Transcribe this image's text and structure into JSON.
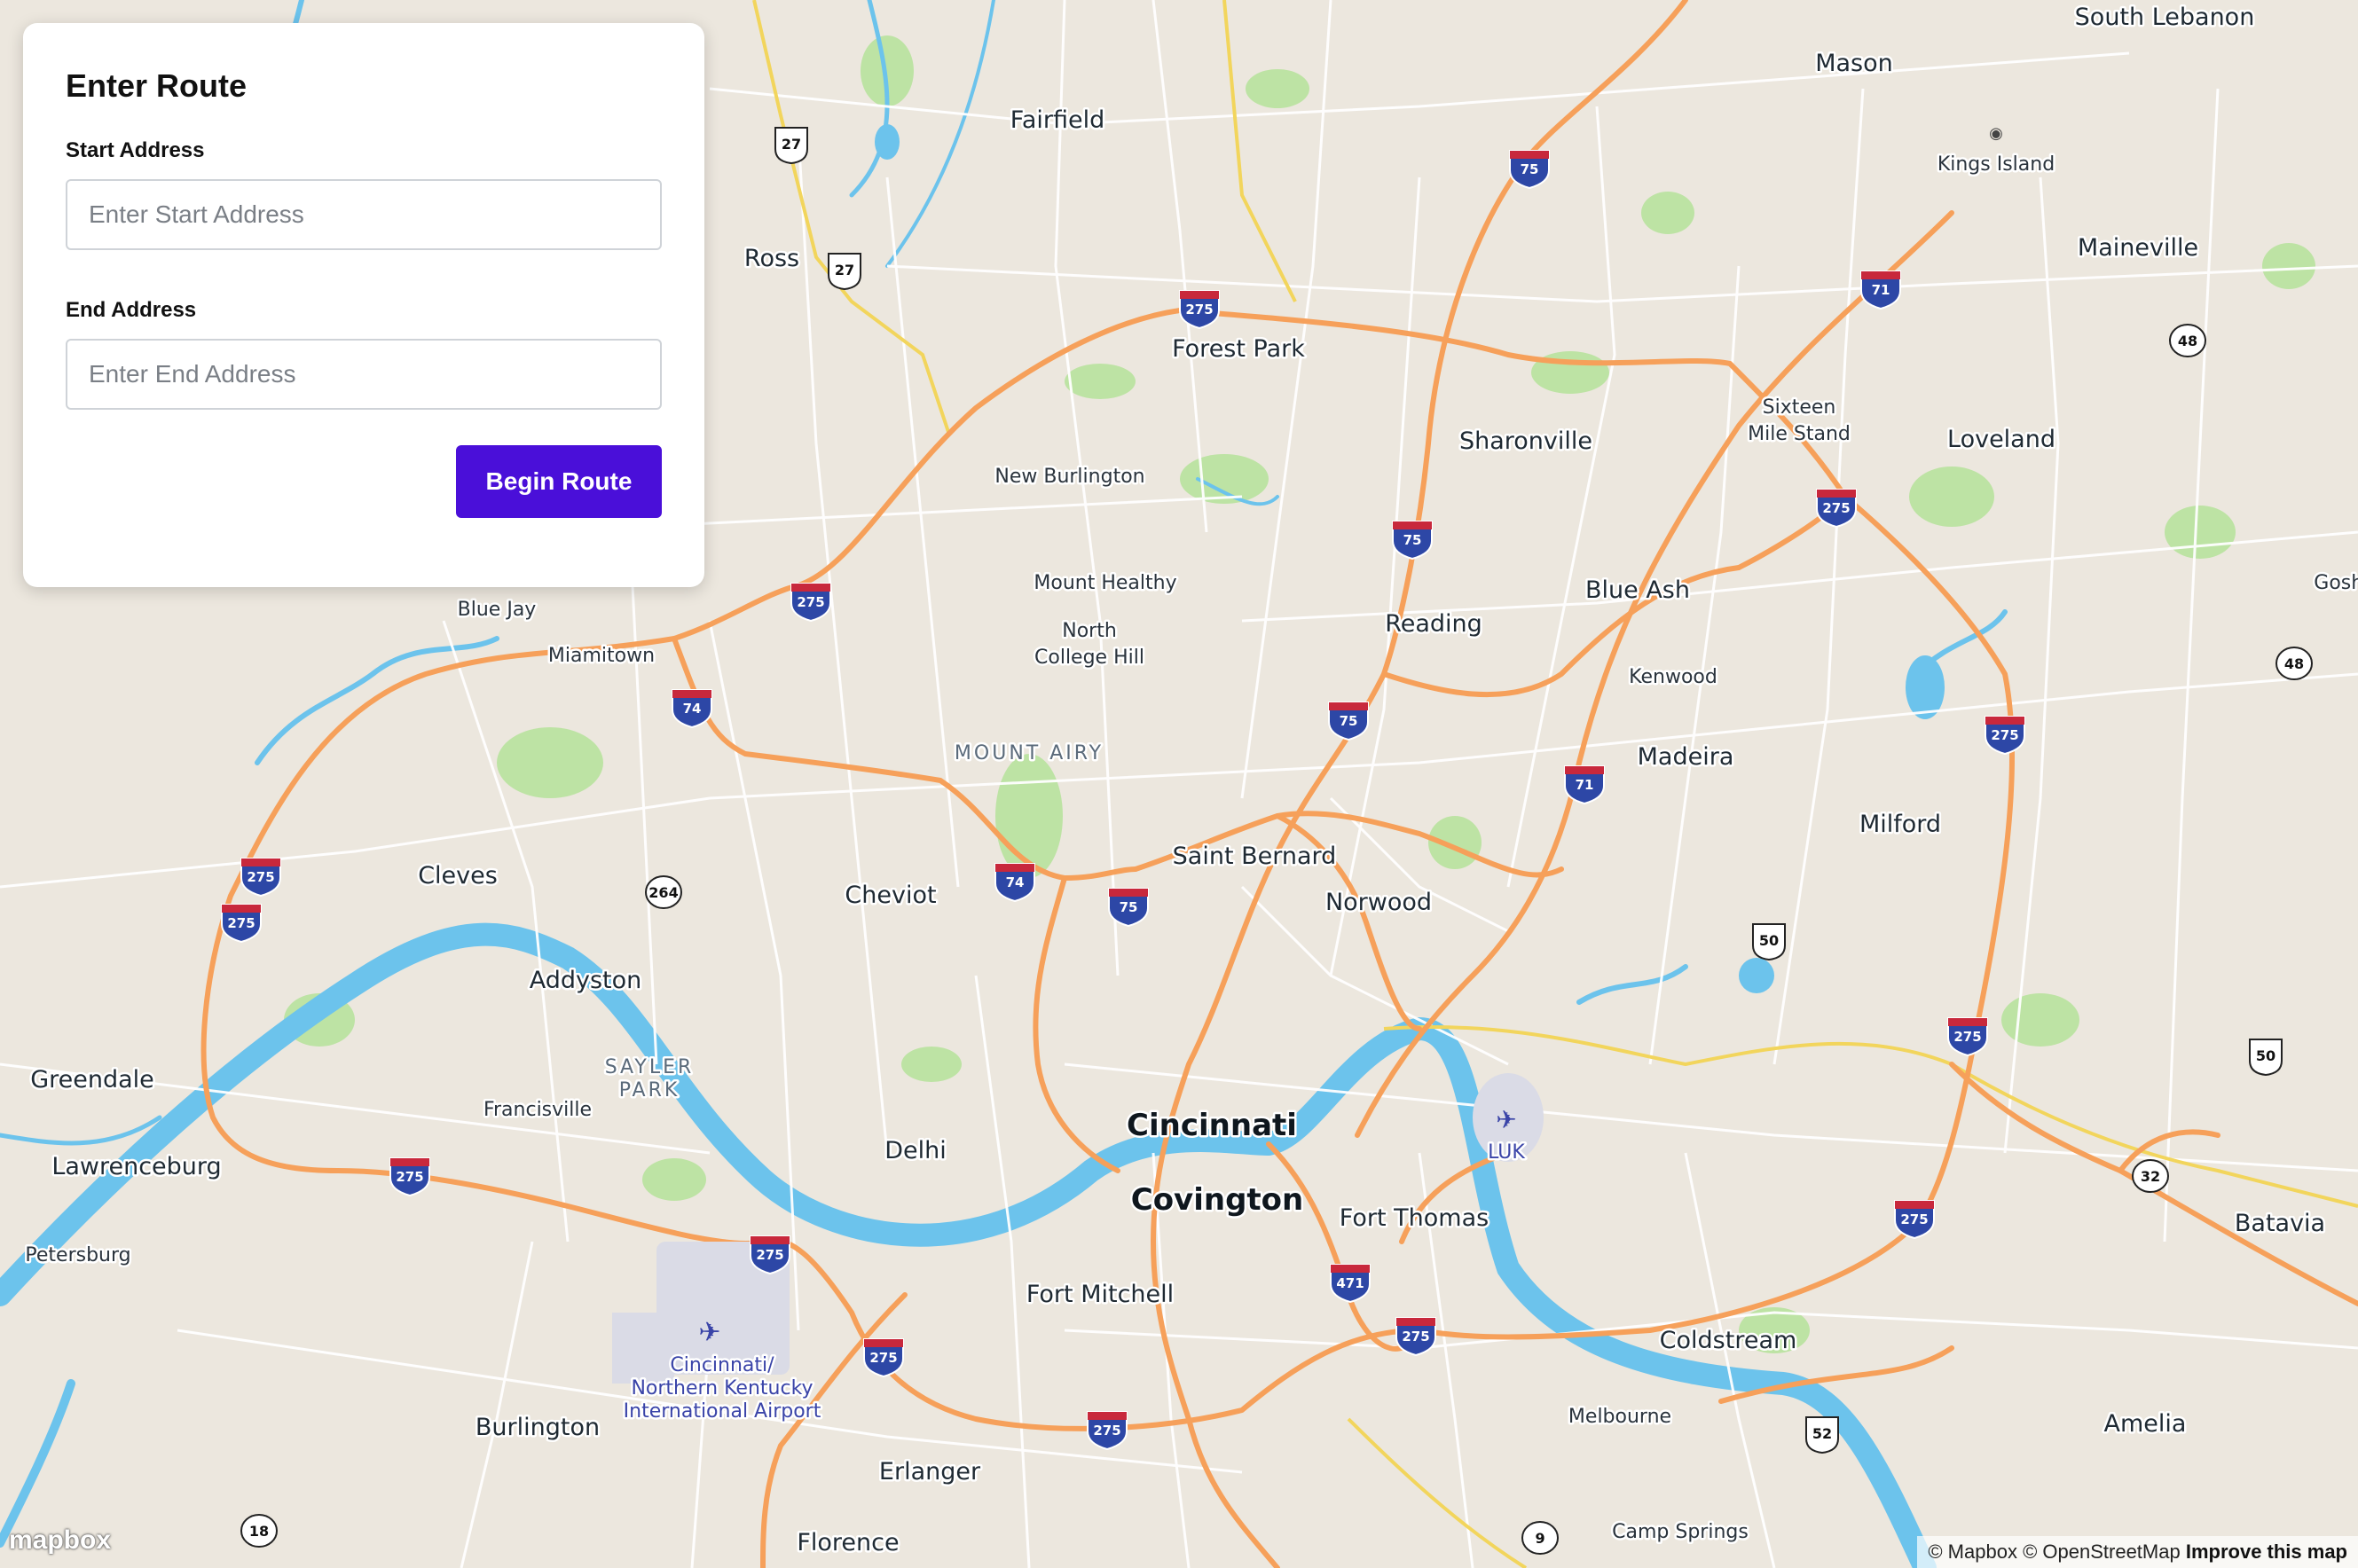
{
  "panel": {
    "title": "Enter Route",
    "start_label": "Start Address",
    "start_placeholder": "Enter Start Address",
    "start_value": "",
    "end_label": "End Address",
    "end_placeholder": "Enter End Address",
    "end_value": "",
    "button_label": "Begin Route"
  },
  "map": {
    "colors": {
      "land": "#ece7de",
      "water": "#6cc3ec",
      "park": "#bde3a4",
      "interstate": "#f6a05a",
      "state_route": "#f2d55c",
      "road": "#ffffff"
    },
    "labels": {
      "south_lebanon": "South Lebanon",
      "mason": "Mason",
      "kings_island": "Kings Island",
      "fairfield": "Fairfield",
      "ross": "Ross",
      "maineville": "Maineville",
      "forest_park": "Forest Park",
      "sharonville": "Sharonville",
      "sixteen": "Sixteen",
      "mile_stand": "Mile Stand",
      "loveland": "Loveland",
      "new_burlington": "New Burlington",
      "mount_healthy": "Mount Healthy",
      "blue_ash": "Blue Ash",
      "goshen": "Goshen",
      "blue_jay": "Blue Jay",
      "miamitown": "Miamitown",
      "north": "North",
      "college_hill": "College Hill",
      "reading": "Reading",
      "kenwood": "Kenwood",
      "mount_airy": "MOUNT AIRY",
      "madeira": "Madeira",
      "milford": "Milford",
      "cleves": "Cleves",
      "cheviot": "Cheviot",
      "saint_bernard": "Saint Bernard",
      "norwood": "Norwood",
      "addyston": "Addyston",
      "greendale": "Greendale",
      "sayler": "SAYLER",
      "park": "PARK",
      "francisville": "Francisville",
      "cincinnati": "Cincinnati",
      "luk": "LUK",
      "lawrenceburg": "Lawrenceburg",
      "delhi": "Delhi",
      "covington": "Covington",
      "fort_thomas": "Fort Thomas",
      "batavia": "Batavia",
      "petersburg": "Petersburg",
      "fort_mitchell": "Fort Mitchell",
      "coldstream": "Coldstream",
      "airport1": "Cincinnati/",
      "airport2": "Northern Kentucky",
      "airport3": "International Airport",
      "burlington": "Burlington",
      "melbourne": "Melbourne",
      "amelia": "Amelia",
      "erlanger": "Erlanger",
      "camp_springs": "Camp Springs",
      "florence": "Florence"
    },
    "shields": {
      "i275": "275",
      "i75": "75",
      "i71": "71",
      "i74": "74",
      "i471": "471",
      "us27": "27",
      "us50": "50",
      "us52": "52",
      "sr48": "48",
      "sr264": "264",
      "sr32": "32",
      "sr18": "18",
      "sr9": "9"
    },
    "attribution": {
      "mapbox": "© Mapbox",
      "osm": "© OpenStreetMap",
      "improve": "Improve this map"
    },
    "logo": "mapbox"
  }
}
